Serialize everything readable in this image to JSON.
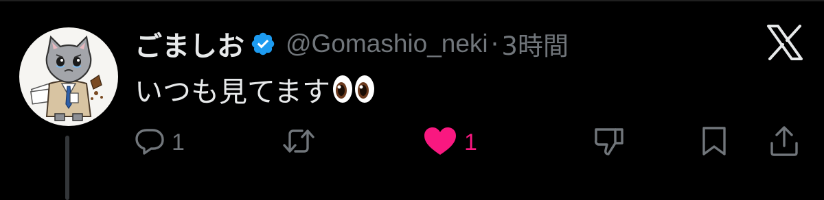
{
  "tweet": {
    "display_name": "ごましお",
    "handle": "@Gomashio_neki",
    "separator": "·",
    "time_ago": "3時間",
    "text": "いつも見てます",
    "emoji": "eyes-emoji",
    "verified": true,
    "verified_color": "#1d9bf0"
  },
  "actions": {
    "reply": {
      "icon": "reply-icon",
      "count": "1"
    },
    "repost": {
      "icon": "repost-icon",
      "count": ""
    },
    "like": {
      "icon": "heart-icon",
      "count": "1",
      "liked": true,
      "color": "#f91880"
    },
    "dislike": {
      "icon": "thumbs-down-icon"
    },
    "bookmark": {
      "icon": "bookmark-icon"
    },
    "share": {
      "icon": "share-icon"
    }
  },
  "colors": {
    "background": "#000000",
    "primary_text": "#e7e9ea",
    "secondary_text": "#71767b",
    "like": "#f91880",
    "verified": "#1d9bf0"
  }
}
